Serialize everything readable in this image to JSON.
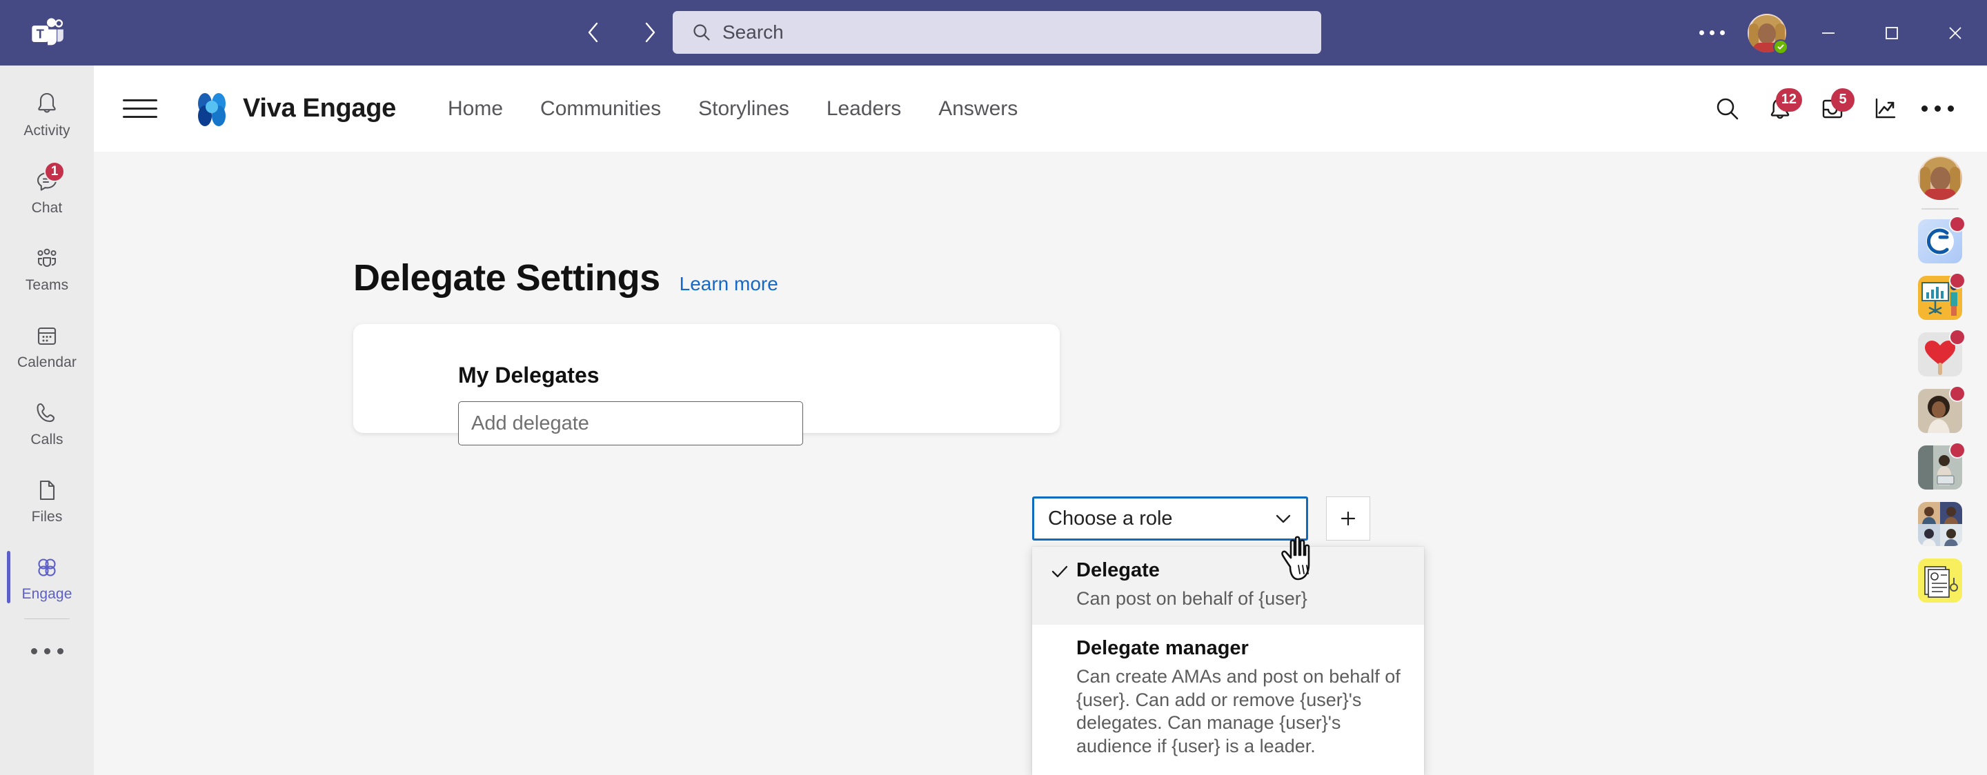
{
  "titlebar": {
    "app_icon": "teams-logo-icon",
    "back_icon": "chevron-left-icon",
    "forward_icon": "chevron-right-icon",
    "search_placeholder": "Search",
    "search_icon": "search-icon",
    "more_icon": "ellipsis-icon",
    "avatar": "user-avatar",
    "presence": "available-status",
    "minimize": "minimize-icon",
    "maximize": "maximize-icon",
    "close": "close-icon",
    "bg_color": "#464a84"
  },
  "left_rail": {
    "items": [
      {
        "label": "Activity",
        "icon": "bell-icon",
        "badge": "",
        "active": false
      },
      {
        "label": "Chat",
        "icon": "chat-icon",
        "badge": "1",
        "active": false
      },
      {
        "label": "Teams",
        "icon": "teams-people-icon",
        "badge": "",
        "active": false
      },
      {
        "label": "Calendar",
        "icon": "calendar-icon",
        "badge": "",
        "active": false
      },
      {
        "label": "Calls",
        "icon": "phone-icon",
        "badge": "",
        "active": false
      },
      {
        "label": "Files",
        "icon": "file-icon",
        "badge": "",
        "active": false
      },
      {
        "label": "Engage",
        "icon": "viva-engage-icon",
        "badge": "",
        "active": true
      }
    ],
    "more_icon": "ellipsis-icon",
    "active_color": "#5b5fc7",
    "badge_color": "#c4314b"
  },
  "app_header": {
    "menu_icon": "hamburger-menu-icon",
    "brand_logo": "viva-engage-logo-icon",
    "brand_name": "Viva Engage",
    "nav": [
      {
        "label": "Home"
      },
      {
        "label": "Communities"
      },
      {
        "label": "Storylines"
      },
      {
        "label": "Leaders"
      },
      {
        "label": "Answers"
      }
    ],
    "actions": [
      {
        "name": "search-icon",
        "badge": ""
      },
      {
        "name": "bell-icon",
        "badge": "12"
      },
      {
        "name": "inbox-icon",
        "badge": "5"
      },
      {
        "name": "analytics-icon",
        "badge": ""
      },
      {
        "name": "ellipsis-icon",
        "badge": ""
      }
    ]
  },
  "page": {
    "title": "Delegate Settings",
    "learn_more": "Learn more",
    "learn_more_color": "#1668c8"
  },
  "card": {
    "title": "My Delegates",
    "delegate_input": {
      "value": "",
      "placeholder": "Add delegate"
    },
    "add_button_icon": "plus-icon"
  },
  "role_select": {
    "value": "Choose a role",
    "chevron_icon": "chevron-down-icon",
    "focus_color": "#0f6cbd",
    "open": true,
    "options": [
      {
        "title": "Delegate",
        "description": "Can post on behalf of {user}",
        "selected": true,
        "check_icon": "checkmark-icon"
      },
      {
        "title": "Delegate manager",
        "description": "Can create AMAs and post on behalf of {user}. Can add or remove {user}'s delegates. Can manage {user}'s audience if {user} is a leader.",
        "selected": false,
        "check_icon": ""
      }
    ]
  },
  "right_rail": {
    "avatar": "user-avatar",
    "tiles": [
      {
        "name": "app-tile-connections",
        "has_dot": true
      },
      {
        "name": "app-tile-presentation",
        "has_dot": true
      },
      {
        "name": "app-tile-heart",
        "has_dot": true
      },
      {
        "name": "app-tile-person-portrait",
        "has_dot": true
      },
      {
        "name": "app-tile-person-laptop",
        "has_dot": true
      },
      {
        "name": "app-tile-group-grid",
        "has_dot": false
      },
      {
        "name": "app-tile-documents",
        "has_dot": false
      }
    ],
    "dot_color": "#c4314b"
  },
  "cursor": {
    "name": "hand-pointer-cursor"
  }
}
